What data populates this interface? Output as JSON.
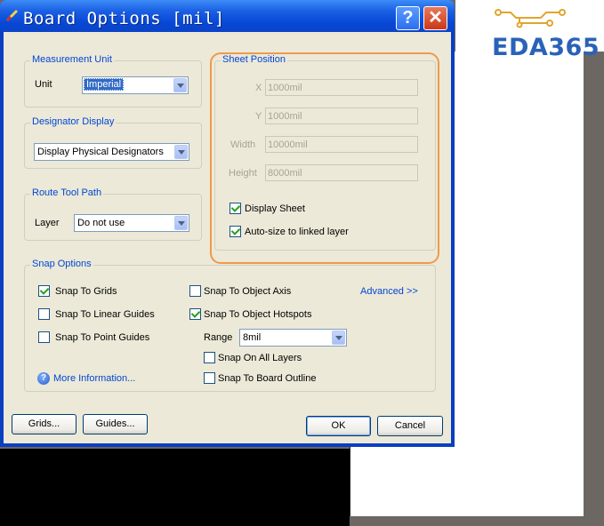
{
  "watermark": {
    "text": "EDA365"
  },
  "window": {
    "title": "Board Options [mil]",
    "help_label": "?",
    "close_label": "✕"
  },
  "measurement_unit": {
    "title": "Measurement Unit",
    "unit_label": "Unit",
    "unit_value": "Imperial"
  },
  "designator_display": {
    "title": "Designator Display",
    "value": "Display Physical Designators"
  },
  "route_tool_path": {
    "title": "Route Tool Path",
    "layer_label": "Layer",
    "layer_value": "Do not use"
  },
  "sheet_position": {
    "title": "Sheet Position",
    "x_label": "X",
    "x_value": "1000mil",
    "y_label": "Y",
    "y_value": "1000mil",
    "width_label": "Width",
    "width_value": "10000mil",
    "height_label": "Height",
    "height_value": "8000mil",
    "display_sheet_label": "Display Sheet",
    "display_sheet_checked": true,
    "auto_size_label": "Auto-size to linked layer",
    "auto_size_checked": true
  },
  "snap_options": {
    "title": "Snap Options",
    "snap_to_grids": "Snap To Grids",
    "snap_to_linear_guides": "Snap To Linear Guides",
    "snap_to_point_guides": "Snap To Point Guides",
    "snap_to_object_axis": "Snap To Object Axis",
    "snap_to_object_hotspots": "Snap To Object Hotspots",
    "range_label": "Range",
    "range_value": "8mil",
    "snap_on_all_layers": "Snap On All Layers",
    "snap_to_board_outline": "Snap To Board Outline",
    "advanced_link": "Advanced >>",
    "more_info_link": "More Information...",
    "info_icon_glyph": "?"
  },
  "buttons": {
    "grids": "Grids...",
    "guides": "Guides...",
    "ok": "OK",
    "cancel": "Cancel"
  },
  "colors": {
    "title_bar": "#0a43c8",
    "group_title": "#0046d5",
    "annotation_highlight": "#ef9a4d"
  }
}
